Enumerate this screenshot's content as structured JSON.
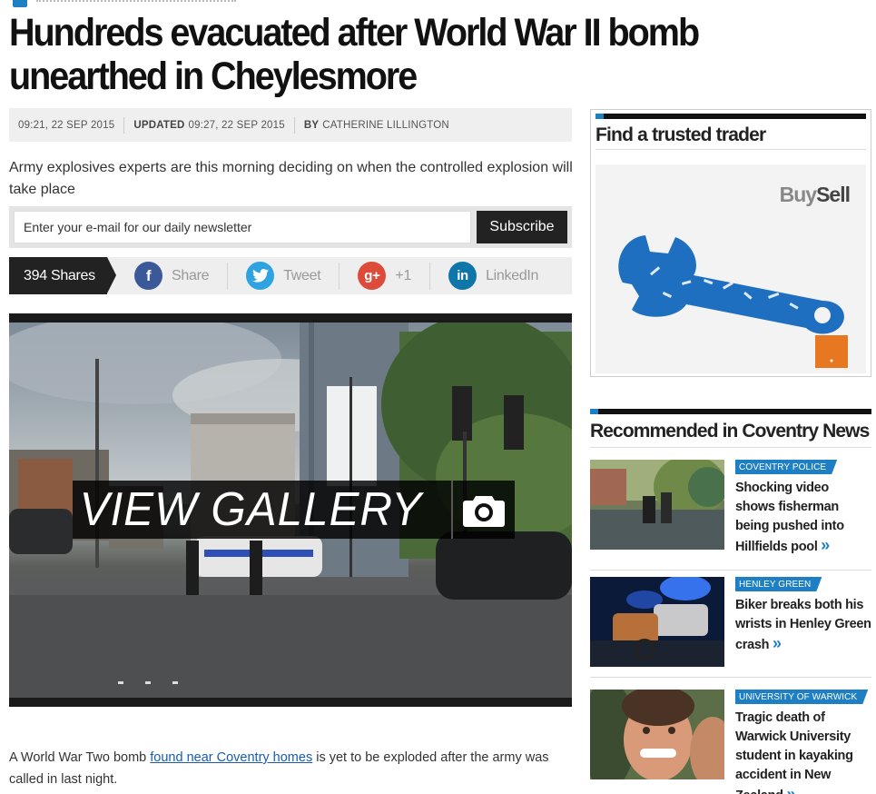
{
  "article": {
    "headline": "Hundreds evacuated after World War II bomb unearthed in Cheylesmore",
    "published": "09:21, 22 SEP 2015",
    "updated_label": "UPDATED",
    "updated": "09:27, 22 SEP 2015",
    "by_label": "BY",
    "author": "CATHERINE LILLINGTON",
    "standfirst": "Army explosives experts are this morning deciding on when the controlled explosion will take place",
    "body_before_link": "A World War Two bomb ",
    "body_link": "found near Coventry homes",
    "body_after_link": " is yet to be exploded after the army was called in last night."
  },
  "newsletter": {
    "placeholder": "Enter your e-mail for our daily newsletter",
    "button": "Subscribe"
  },
  "share": {
    "count": "394 Shares",
    "facebook": "Share",
    "twitter": "Tweet",
    "googleplus": "+1",
    "linkedin": "LinkedIn"
  },
  "gallery": {
    "label": "VIEW GALLERY"
  },
  "sidebar": {
    "trader_title": "Find a trusted trader",
    "ad_brand_buy": "Buy",
    "ad_brand_sell": "Sell",
    "recommended_title": "Recommended in Coventry News",
    "items": [
      {
        "tag": "COVENTRY POLICE",
        "headline": "Shocking video shows fisherman being pushed into Hillfields pool"
      },
      {
        "tag": "HENLEY GREEN",
        "headline": "Biker breaks both his wrists in Henley Green crash"
      },
      {
        "tag": "UNIVERSITY OF WARWICK",
        "headline": "Tragic death of Warwick University student in kayaking accident in New Zealand"
      }
    ]
  },
  "icons": {
    "more_link": "»"
  },
  "colors": {
    "accent": "#1f7fc4",
    "facebook": "#3b5998",
    "twitter": "#2ea3e0",
    "googleplus": "#dd4b39",
    "linkedin": "#0e76a8"
  }
}
